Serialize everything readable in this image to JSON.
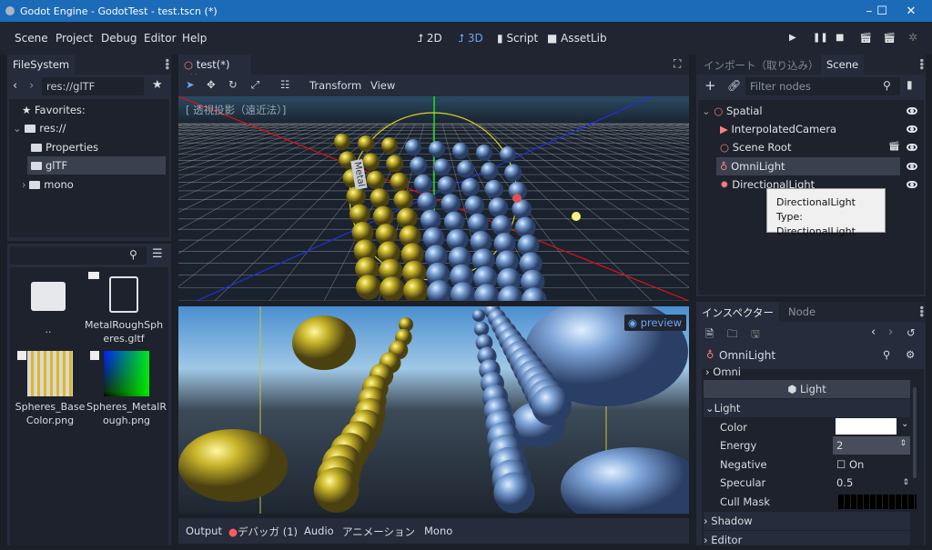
{
  "window": {
    "title": "Godot Engine - GodotTest - test.tscn (*)",
    "minimize": "–",
    "maximize": "☐",
    "close": "✕"
  },
  "menu": [
    "Scene",
    "Project",
    "Debug",
    "Editor",
    "Help"
  ],
  "workspaces": [
    {
      "label": "2D",
      "icon": "2d-icon"
    },
    {
      "label": "3D",
      "icon": "3d-icon",
      "active": true
    },
    {
      "label": "Script",
      "icon": "script-icon"
    },
    {
      "label": "AssetLib",
      "icon": "assetlib-icon"
    }
  ],
  "run_buttons": [
    "play-icon",
    "pause-icon",
    "stop-icon",
    "play-scene-icon",
    "play-custom-scene-icon",
    "loading-icon"
  ],
  "filesystem": {
    "tab": "FileSystem",
    "path": "res://glTF",
    "tree": [
      {
        "label": "Favorites:",
        "icon": "star-icon"
      },
      {
        "label": "res://",
        "icon": "folder-icon"
      },
      {
        "label": "Properties",
        "icon": "folder-icon"
      },
      {
        "label": "glTF",
        "icon": "folder-icon",
        "selected": true
      },
      {
        "label": "mono",
        "icon": "folder-icon"
      }
    ],
    "search_placeholder": "",
    "files": [
      {
        "name": "..",
        "type": "folder"
      },
      {
        "name": "MetalRoughSpheres.gltf",
        "type": "scene"
      },
      {
        "name": "Spheres_BaseColor.png",
        "type": "image"
      },
      {
        "name": "Spheres_MetalRough.png",
        "type": "image"
      }
    ]
  },
  "editor": {
    "tab": "test(*)",
    "toolbar": {
      "transform": "Transform",
      "view": "View"
    },
    "viewport_label": "[ 透視投影（遠近法）]",
    "preview_label": "preview",
    "label_metal": "Metal"
  },
  "bottom_panel": {
    "output": "Output",
    "debugger": "デバッガ (1)",
    "audio": "Audio",
    "animation": "アニメーション",
    "mono": "Mono",
    "debugger_dot_color": "#ff5d5d"
  },
  "scene_dock": {
    "tabs": [
      "インポート（取り込み）",
      "Scene"
    ],
    "filter_placeholder": "Filter nodes",
    "nodes": [
      {
        "label": "Spatial",
        "depth": 0
      },
      {
        "label": "InterpolatedCamera",
        "depth": 1
      },
      {
        "label": "Scene Root",
        "depth": 1,
        "has_scene_icon": true
      },
      {
        "label": "OmniLight",
        "depth": 1,
        "selected": true
      },
      {
        "label": "DirectionalLight",
        "depth": 1
      }
    ],
    "tooltip": {
      "line1": "DirectionalLight",
      "line2": "Type: DirectionalLight"
    }
  },
  "inspector": {
    "tabs": [
      "インスペクター",
      "Node"
    ],
    "node_name": "OmniLight",
    "sections": {
      "omni": "Omni",
      "light_header": "Light",
      "light": "Light",
      "shadow": "Shadow",
      "editor": "Editor"
    },
    "properties": [
      {
        "name": "Color",
        "value": "#ffffff"
      },
      {
        "name": "Energy",
        "value": "2"
      },
      {
        "name": "Negative",
        "value": "On",
        "checked": false
      },
      {
        "name": "Specular",
        "value": "0.5"
      },
      {
        "name": "Cull Mask",
        "value": ""
      }
    ]
  },
  "colors": {
    "accent": "#6ea6ee",
    "titlebar": "#1c6bb8",
    "base": "#202531"
  }
}
